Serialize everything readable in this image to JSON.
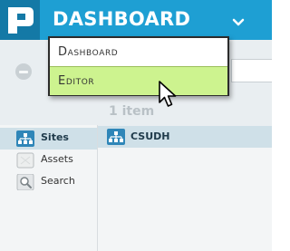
{
  "header": {
    "title": "DASHBOARD",
    "logo_icon": "p-logo-icon",
    "caret_icon": "chevron-down-icon",
    "brand_color": "#1e9fd3"
  },
  "menu": {
    "items": [
      {
        "label": "Dashboard",
        "state": "normal"
      },
      {
        "label": "Editor",
        "state": "hovered"
      }
    ],
    "hover_color": "#cdf38f"
  },
  "list": {
    "count_label": "1 item",
    "rows": [
      {
        "label": "CSUDH",
        "icon": "sitemap-icon"
      }
    ]
  },
  "sidebar": {
    "items": [
      {
        "label": "Sites",
        "icon": "sitemap-icon",
        "active": true
      },
      {
        "label": "Assets",
        "icon": "assets-icon",
        "active": false
      },
      {
        "label": "Search",
        "icon": "magnifier-icon",
        "active": false
      }
    ]
  },
  "toolbar": {
    "remove_icon": "minus-circle-icon"
  }
}
